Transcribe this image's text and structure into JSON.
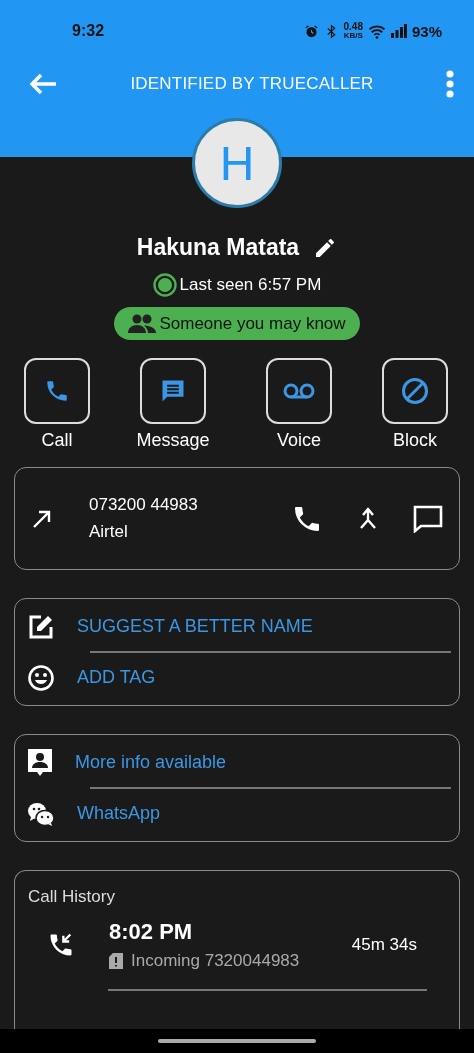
{
  "status_bar": {
    "time": "9:32",
    "net_speed": "0.48",
    "net_unit": "KB/S",
    "battery": "93%"
  },
  "app_bar": {
    "title": "IDENTIFIED BY TRUECALLER"
  },
  "profile": {
    "initial": "H",
    "name": "Hakuna Matata",
    "last_seen": "Last seen 6:57 PM",
    "badge": "Someone you may know"
  },
  "actions": [
    {
      "label": "Call"
    },
    {
      "label": "Message"
    },
    {
      "label": "Voice"
    },
    {
      "label": "Block"
    }
  ],
  "number_card": {
    "number": "073200 44983",
    "carrier": "Airtel"
  },
  "suggest_card": [
    {
      "label": "SUGGEST A BETTER NAME"
    },
    {
      "label": "ADD TAG"
    }
  ],
  "info_card": [
    {
      "label": "More info available"
    },
    {
      "label": "WhatsApp"
    }
  ],
  "call_history": {
    "title": "Call History",
    "entries": [
      {
        "time": "8:02 PM",
        "detail": "Incoming 7320044983",
        "duration": "45m 34s"
      }
    ]
  }
}
